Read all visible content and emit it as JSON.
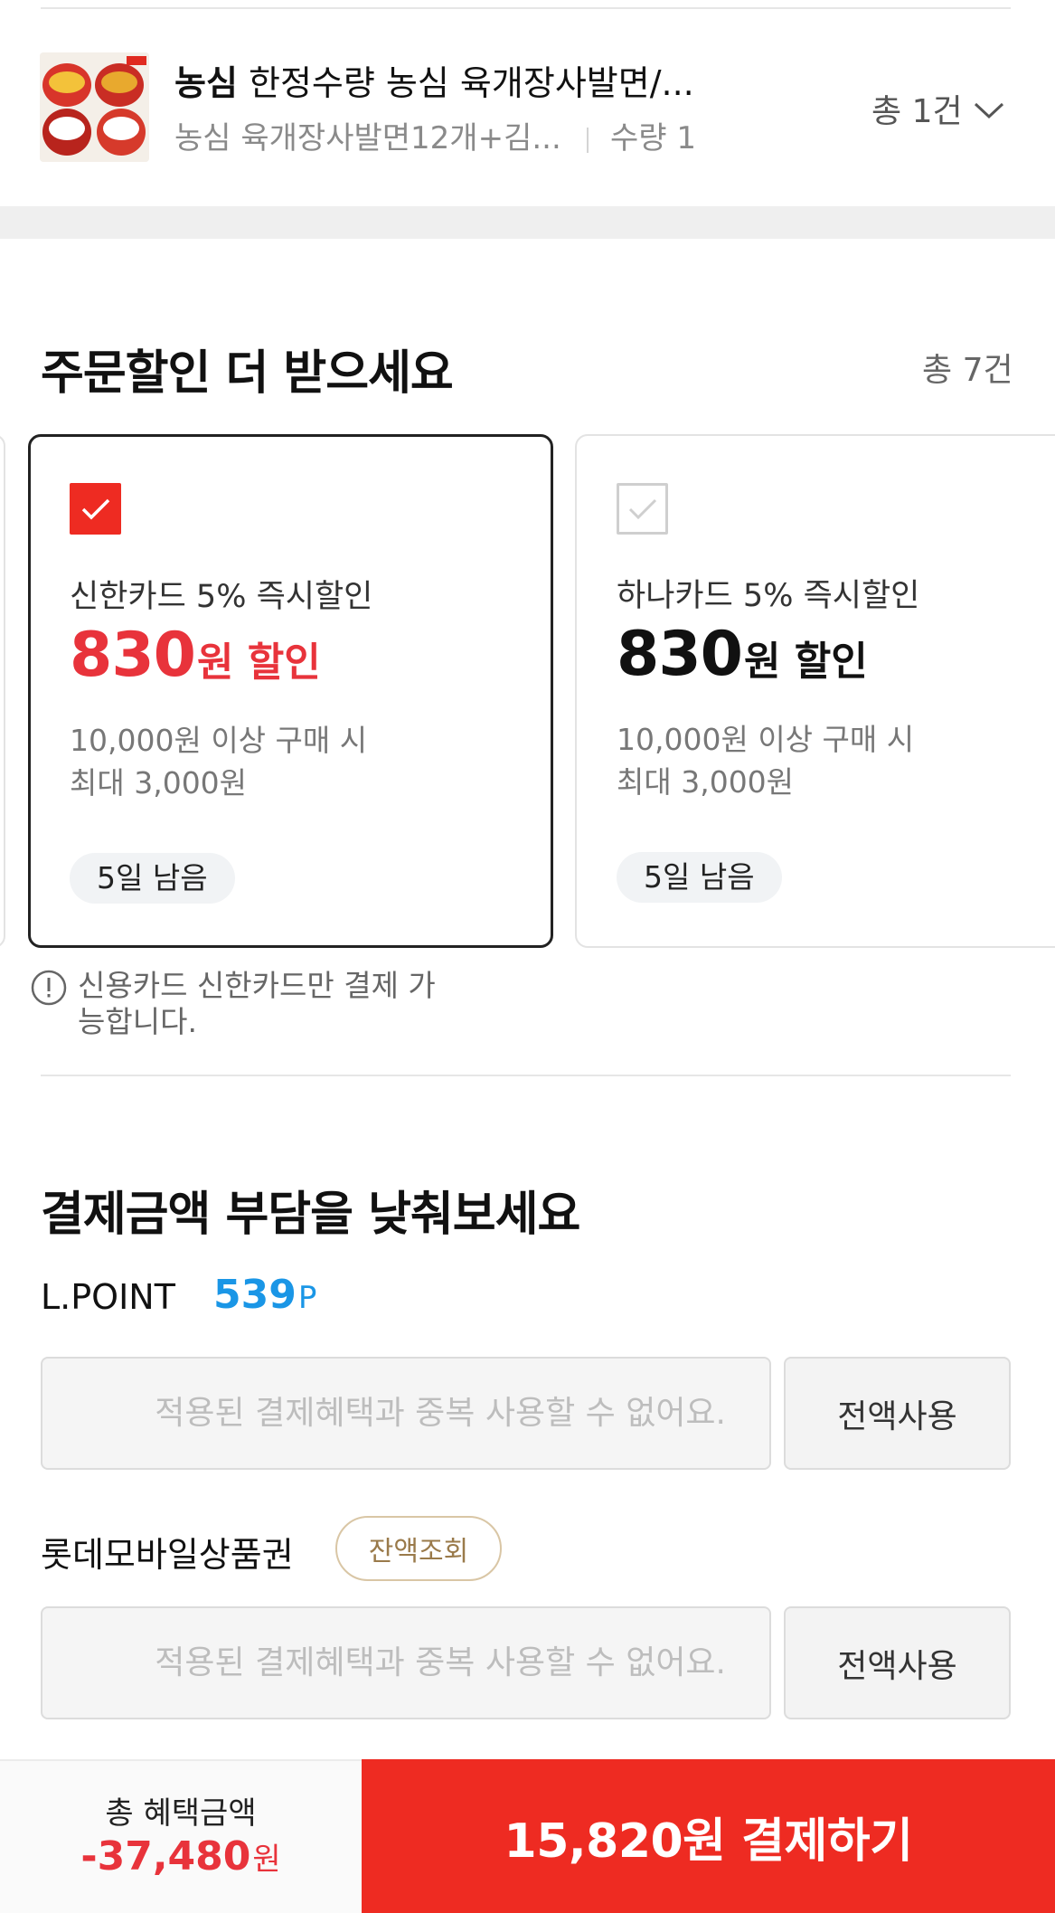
{
  "product": {
    "brand": "농심",
    "title": "한정수량 농심 육개장사발면/...",
    "option": "농심 육개장사발면12개+김...",
    "quantity": "수량 1",
    "total_count": "총 1건"
  },
  "order_discount": {
    "title": "주문할인 더 받으세요",
    "count": "총 7건",
    "cards": [
      {
        "name": "신한카드 5% 즉시할인",
        "amount": "830",
        "amount_unit": "원 할인",
        "condition_line1": "10,000원 이상 구매 시",
        "condition_line2": "최대 3,000원",
        "remaining": "5일 남음",
        "selected": true
      },
      {
        "name": "하나카드 5% 즉시할인",
        "amount": "830",
        "amount_unit": "원 할인",
        "condition_line1": "10,000원 이상 구매 시",
        "condition_line2": "최대 3,000원",
        "remaining": "5일 남음",
        "selected": false
      }
    ],
    "notice": "신용카드 신한카드만 결제 가능합니다."
  },
  "payment_reduce": {
    "title": "결제금액 부담을 낮춰보세요",
    "lpoint": {
      "label": "L.POINT",
      "value": "539",
      "unit": "P",
      "placeholder": "적용된 결제혜택과 중복 사용할 수 없어요.",
      "use_all_label": "전액사용"
    },
    "gift": {
      "label": "롯데모바일상품권",
      "balance_button": "잔액조회",
      "placeholder": "적용된 결제혜택과 중복 사용할 수 없어요.",
      "use_all_label": "전액사용"
    }
  },
  "bottom_bar": {
    "benefit_label": "총 혜택금액",
    "benefit_amount": "-37,480",
    "benefit_unit": "원",
    "pay_label": "15,820원 결제하기"
  },
  "colors": {
    "accent_red": "#ee2b22",
    "discount_red": "#e8333b",
    "point_blue": "#1a96e6",
    "gift_brown": "#9a7a4a"
  }
}
